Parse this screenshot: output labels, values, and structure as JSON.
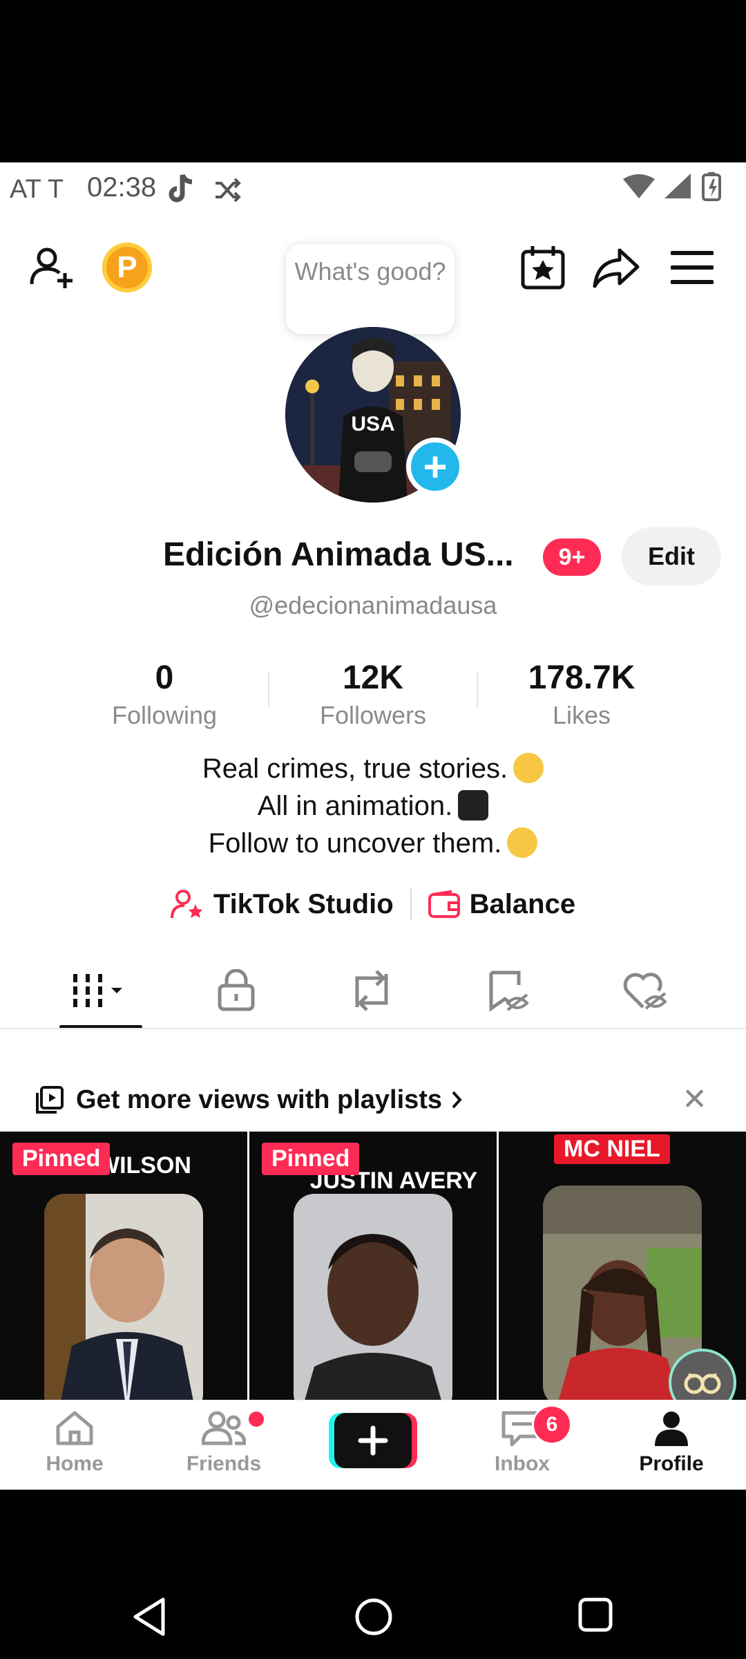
{
  "status_bar": {
    "carrier": "AT T",
    "time": "02:38"
  },
  "header": {
    "coin_label": "P",
    "tooltip": "What's good?"
  },
  "profile": {
    "name": "Edición Animada US...",
    "notif_badge": "9+",
    "edit_label": "Edit",
    "handle": "@edecionanimadausa"
  },
  "stats": [
    {
      "value": "0",
      "label": "Following"
    },
    {
      "value": "12K",
      "label": "Followers"
    },
    {
      "value": "178.7K",
      "label": "Likes"
    }
  ],
  "bio": [
    "Real crimes, true stories.",
    "All in animation.",
    "Follow to uncover them."
  ],
  "links": {
    "studio": "TikTok Studio",
    "balance": "Balance"
  },
  "promo": {
    "text": "Get more views with playlists"
  },
  "videos": [
    {
      "pinned": "Pinned",
      "title": "WILSON"
    },
    {
      "pinned": "Pinned",
      "title": "JUSTIN AVERY"
    },
    {
      "pinned": "",
      "title": "MC NIEL"
    }
  ],
  "nav": {
    "home": "Home",
    "friends": "Friends",
    "inbox": "Inbox",
    "profile": "Profile",
    "inbox_badge": "6"
  },
  "colors": {
    "accent": "#fe2c55",
    "avatar_plus": "#22b8ec",
    "coin": "#f6a21b"
  }
}
